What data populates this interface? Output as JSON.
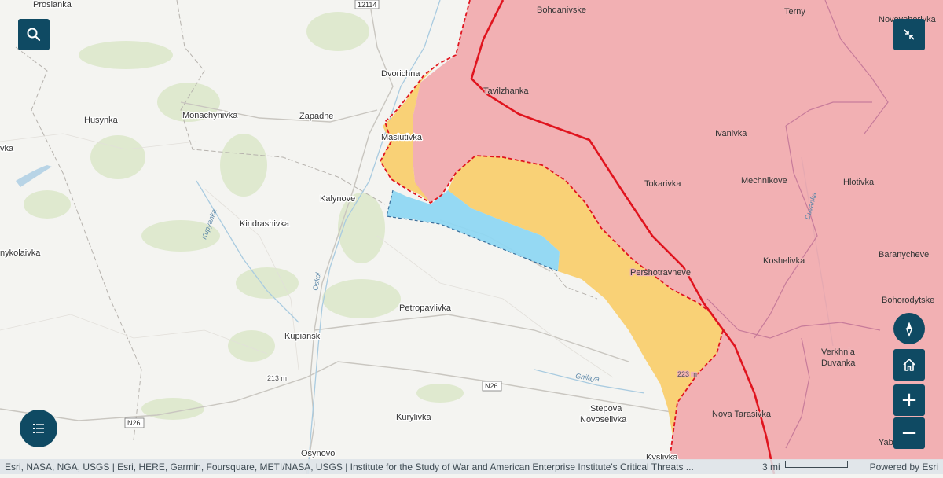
{
  "map": {
    "places": [
      {
        "id": "prosianka",
        "name": "Prosianka"
      },
      {
        "id": "bohdanivske",
        "name": "Bohdanivske"
      },
      {
        "id": "terny",
        "name": "Terny"
      },
      {
        "id": "novoyehorivka",
        "name": "Novoyehorivka"
      },
      {
        "id": "dvorichna",
        "name": "Dvorichna"
      },
      {
        "id": "tavilzhanka",
        "name": "Tavilzhanka"
      },
      {
        "id": "husynka",
        "name": "Husynka"
      },
      {
        "id": "monachynivka",
        "name": "Monachynivka"
      },
      {
        "id": "zapadne",
        "name": "Zapadne"
      },
      {
        "id": "masiutivka",
        "name": "Masiutivka"
      },
      {
        "id": "ivanivka",
        "name": "Ivanivka"
      },
      {
        "id": "tokarivka",
        "name": "Tokarivka"
      },
      {
        "id": "mechnikove",
        "name": "Mechnikove"
      },
      {
        "id": "hlotivka",
        "name": "Hlotivka"
      },
      {
        "id": "kalynove",
        "name": "Kalynove"
      },
      {
        "id": "kindrashivka",
        "name": "Kindrashivka"
      },
      {
        "id": "mykolaivka",
        "name": "nykolaivka"
      },
      {
        "id": "pershotravneve",
        "name": "Pershotravneve"
      },
      {
        "id": "koshelivka",
        "name": "Koshelivka"
      },
      {
        "id": "baranycheve",
        "name": "Baranycheve"
      },
      {
        "id": "bohorodytske",
        "name": "Bohorodytske"
      },
      {
        "id": "petropavlivka",
        "name": "Petropavlivka"
      },
      {
        "id": "kupiansk",
        "name": "Kupiansk"
      },
      {
        "id": "verkhnia",
        "name": "Verkhnia"
      },
      {
        "id": "duvanka",
        "name": "Duvanka"
      },
      {
        "id": "stepova",
        "name": "Stepova"
      },
      {
        "id": "novoselivka",
        "name": "Novoselivka"
      },
      {
        "id": "nova-tarasivka",
        "name": "Nova Tarasivka"
      },
      {
        "id": "kurylivka",
        "name": "Kurylivka"
      },
      {
        "id": "yablunivka",
        "name": "Yablunivk"
      },
      {
        "id": "osynovo",
        "name": "Osynovo"
      },
      {
        "id": "kyslivka",
        "name": "Kyslivka"
      },
      {
        "id": "edge-vka",
        "name": "vka"
      }
    ],
    "rivers": [
      {
        "id": "kupyanka",
        "name": "Kupyanka"
      },
      {
        "id": "oskol",
        "name": "Oskol"
      },
      {
        "id": "gnilaya",
        "name": "Gnilaya"
      },
      {
        "id": "duvanka-river",
        "name": "Duvanka"
      }
    ],
    "roads": [
      {
        "id": "r12114",
        "name": "12114"
      },
      {
        "id": "n26-east",
        "name": "N26"
      },
      {
        "id": "n26-west",
        "name": "N26"
      }
    ],
    "elevations": [
      {
        "id": "e213",
        "name": "213 m"
      },
      {
        "id": "e223",
        "name": "223 m"
      }
    ],
    "colors": {
      "occupied_fill": "#f1a3a8",
      "frontline": "#e0141e",
      "contested_fill": "#f9cf6f",
      "ukrainian_advance_fill": "#8fd7f2",
      "background": "#f4f4f1",
      "button": "#0f4a63"
    }
  },
  "controls": {
    "search_icon": "search-icon",
    "collapse_icon": "collapse-icon",
    "compass_icon": "compass-icon",
    "home_icon": "home-icon",
    "zoom_in_label": "+",
    "zoom_out_label": "−",
    "legend_icon": "list-icon"
  },
  "attribution": {
    "text": "Esri, NASA, NGA, USGS | Esri, HERE, Garmin, Foursquare, METI/NASA, USGS | Institute for the Study of War and American Enterprise Institute's Critical Threats ...",
    "scale_label": "3 mi",
    "powered_by": "Powered by Esri"
  }
}
